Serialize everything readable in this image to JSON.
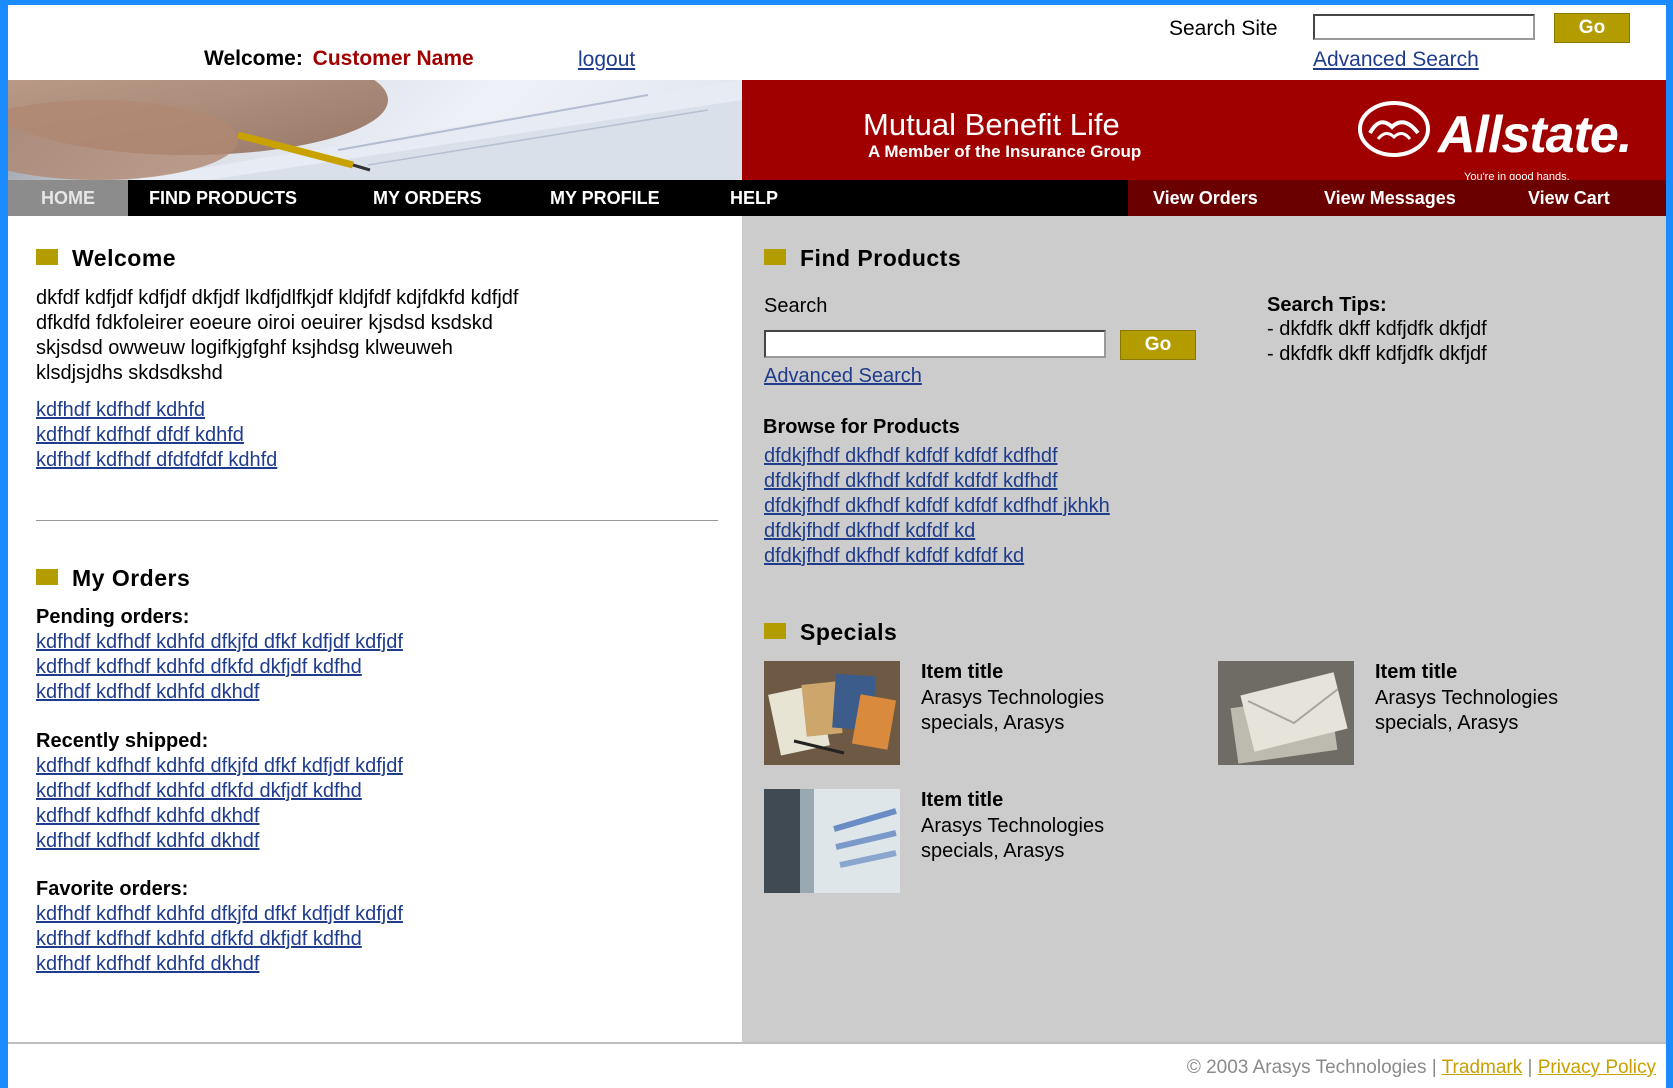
{
  "header": {
    "welcome_label": "Welcome:",
    "customer_name": "Customer Name",
    "logout": "logout",
    "search_label": "Search Site",
    "search_value": "",
    "go": "Go",
    "advanced_search": "Advanced Search"
  },
  "banner": {
    "title": "Mutual Benefit Life",
    "subtitle": "A Member of the Insurance Group",
    "logo_text": "Allstate.",
    "logo_tagline": "You're in good hands."
  },
  "nav": {
    "left": [
      "HOME",
      "FIND PRODUCTS",
      "MY ORDERS",
      "MY PROFILE",
      "HELP"
    ],
    "right": [
      "View Orders",
      "View Messages",
      "View Cart"
    ]
  },
  "welcome": {
    "heading": "Welcome",
    "body": [
      "dkfdf kdfjdf kdfjdf dkfjdf lkdfjdlfkjdf kldjfdf kdjfdkfd kdfjdf",
      "dfkdfd fdkfoleirer eoeure oiroi oeuirer kjsdsd ksdskd",
      "skjsdsd owweuw logifkjgfghf ksjhdsg klweuweh",
      "klsdjsjdhs skdsdkshd"
    ],
    "links": [
      "kdfhdf kdfhdf kdhfd",
      "kdfhdf kdfhdf dfdf kdhfd",
      "kdfhdf kdfhdf dfdfdfdf kdhfd"
    ]
  },
  "orders": {
    "heading": "My Orders",
    "pending_label": "Pending orders:",
    "pending": [
      "kdfhdf kdfhdf kdhfd dfkjfd dfkf kdfjdf kdfjdf",
      "kdfhdf kdfhdf kdhfd dfkfd dkfjdf kdfhd",
      "kdfhdf kdfhdf kdhfd dkhdf"
    ],
    "shipped_label": "Recently shipped:",
    "shipped": [
      "kdfhdf kdfhdf kdhfd dfkjfd dfkf kdfjdf kdfjdf",
      "kdfhdf kdfhdf kdhfd dfkfd dkfjdf kdfhd",
      "kdfhdf kdfhdf kdhfd dkhdf",
      "kdfhdf kdfhdf kdhfd dkhdf"
    ],
    "favorite_label": "Favorite orders:",
    "favorite": [
      "kdfhdf kdfhdf kdhfd dfkjfd dfkf kdfjdf kdfjdf",
      "kdfhdf kdfhdf kdhfd dfkfd dkfjdf kdfhd",
      "kdfhdf kdfhdf kdhfd dkhdf"
    ]
  },
  "find": {
    "heading": "Find Products",
    "search_label": "Search",
    "search_value": "",
    "go": "Go",
    "advanced_search": "Advanced Search",
    "tips_label": "Search Tips:",
    "tips": [
      "- dkfdfk dkff kdfjdfk dkfjdf",
      "- dkfdfk dkff kdfjdfk dkfjdf"
    ],
    "browse_label": "Browse for Products",
    "browse": [
      "dfdkjfhdf dkfhdf kdfdf kdfdf kdfhdf",
      "dfdkjfhdf dkfhdf kdfdf kdfdf kdfhdf",
      "dfdkjfhdf dkfhdf kdfdf kdfdf kdfhdf jkhkh",
      "dfdkjfhdf dkfhdf kdfdf kd",
      "dfdkjfhdf dkfhdf kdfdf kdfdf kd"
    ]
  },
  "specials": {
    "heading": "Specials",
    "items": [
      {
        "title": "Item title",
        "desc": "Arasys Technologies specials, Arasys",
        "image": "brochures-photo"
      },
      {
        "title": "Item title",
        "desc": "Arasys Technologies specials, Arasys",
        "image": "envelopes-photo"
      },
      {
        "title": "Item title",
        "desc": "Arasys Technologies specials, Arasys",
        "image": "retirement-account-photo"
      }
    ]
  },
  "footer": {
    "copyright": "© 2003 Arasys Technologies |",
    "trademark": "Tradmark",
    "sep": "|",
    "privacy": "Privacy Policy"
  },
  "colors": {
    "accent_gold": "#b39c00",
    "brand_red": "#a00000",
    "link_blue": "#1f3c8c",
    "page_border_blue": "#1a8cff"
  }
}
